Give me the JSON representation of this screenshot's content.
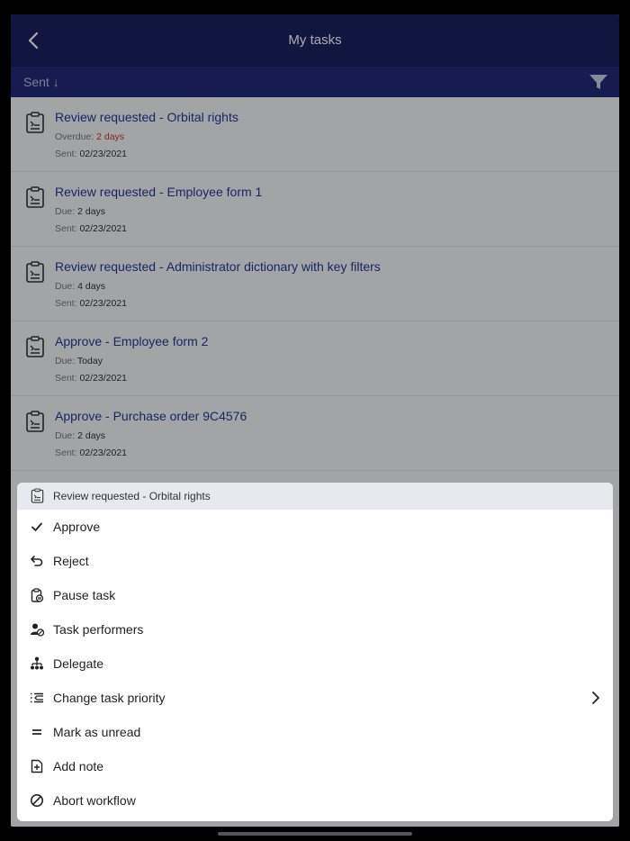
{
  "header": {
    "title": "My tasks"
  },
  "sortbar": {
    "sort_label": "Sent ↓"
  },
  "tasks": [
    {
      "title": "Review requested - Orbital rights",
      "due_label": "Overdue:",
      "due_value": "2 days",
      "sent_label": "Sent:",
      "sent_value": "02/23/2021"
    },
    {
      "title": "Review requested - Employee form 1",
      "due_label": "Due:",
      "due_value": "2 days",
      "sent_label": "Sent:",
      "sent_value": "02/23/2021"
    },
    {
      "title": "Review requested - Administrator dictionary with key filters",
      "due_label": "Due:",
      "due_value": "4 days",
      "sent_label": "Sent:",
      "sent_value": "02/23/2021"
    },
    {
      "title": "Approve - Employee form 2",
      "due_label": "Due:",
      "due_value": "Today",
      "sent_label": "Sent:",
      "sent_value": "02/23/2021"
    },
    {
      "title": "Approve - Purchase order 9C4576",
      "due_label": "Due:",
      "due_value": "2 days",
      "sent_label": "Sent:",
      "sent_value": "02/23/2021"
    }
  ],
  "context_menu": {
    "title": "Review requested - Orbital rights",
    "items": [
      {
        "label": "Approve",
        "icon": "check-icon"
      },
      {
        "label": "Reject",
        "icon": "undo-icon"
      },
      {
        "label": "Pause task",
        "icon": "pause-task-icon"
      },
      {
        "label": "Task performers",
        "icon": "performers-icon"
      },
      {
        "label": "Delegate",
        "icon": "delegate-icon"
      },
      {
        "label": "Change task priority",
        "icon": "priority-icon"
      },
      {
        "label": "Mark as unread",
        "icon": "equals-icon"
      },
      {
        "label": "Add note",
        "icon": "add-note-icon"
      },
      {
        "label": "Abort workflow",
        "icon": "abort-icon"
      }
    ]
  },
  "colors": {
    "header_bg": "#1a2260",
    "sortbar_bg": "#1f2a78",
    "task_title": "#233a96",
    "overdue": "#c0392b"
  }
}
